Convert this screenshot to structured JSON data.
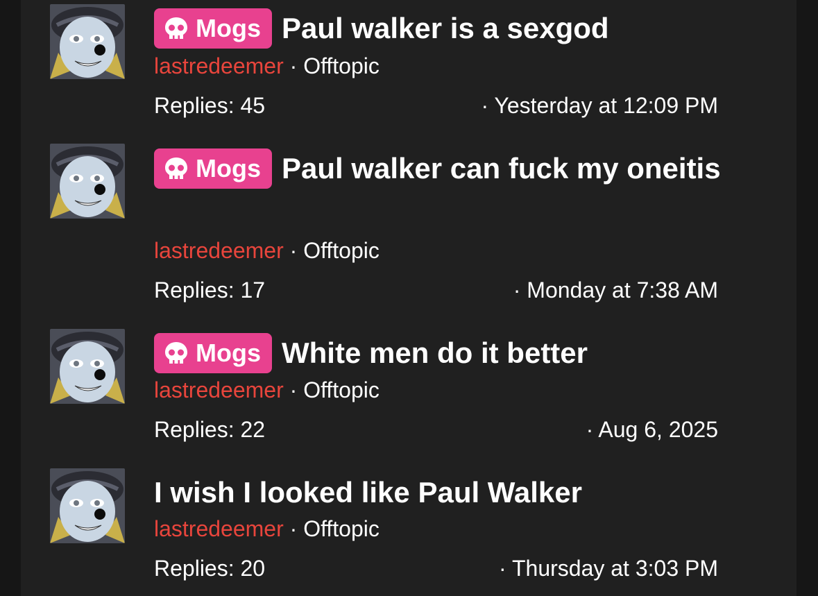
{
  "threads": [
    {
      "prefix": "Mogs",
      "title": "Paul walker is a sexgod",
      "author": "lastredeemer",
      "separator": " · ",
      "forum": "Offtopic",
      "replies": "Replies: 45",
      "date": "· Yesterday at 12:09 PM"
    },
    {
      "prefix": "Mogs",
      "title": "Paul walker can fuck my oneitis",
      "author": "lastredeemer",
      "separator": " · ",
      "forum": "Offtopic",
      "replies": "Replies: 17",
      "date": "· Monday at 7:38 AM"
    },
    {
      "prefix": "Mogs",
      "title": "White men do it better",
      "author": "lastredeemer",
      "separator": " · ",
      "forum": "Offtopic",
      "replies": "Replies: 22",
      "date": "· Aug 6, 2025"
    },
    {
      "prefix": "",
      "title": "I wish I looked like Paul Walker",
      "author": "lastredeemer",
      "separator": " · ",
      "forum": "Offtopic",
      "replies": "Replies: 20",
      "date": "· Thursday at 3:03 PM"
    }
  ],
  "colors": {
    "background": "#202020",
    "badge": "#e8418f",
    "author": "#e8453c",
    "text": "#ffffff"
  },
  "icons": {
    "badge_icon": "skull-icon"
  }
}
